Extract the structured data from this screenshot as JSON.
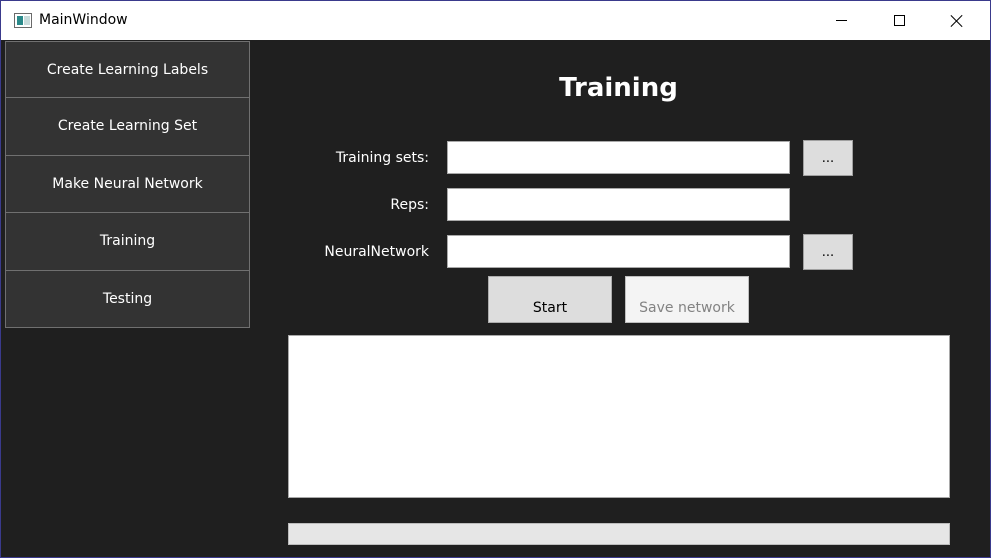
{
  "window": {
    "title": "MainWindow",
    "icons": {
      "app": "app-window-icon",
      "minimize": "minimize-icon",
      "maximize": "maximize-icon",
      "close": "close-icon"
    }
  },
  "sidebar": {
    "items": [
      {
        "label": "Create Learning Labels"
      },
      {
        "label": "Create Learning Set"
      },
      {
        "label": "Make Neural Network"
      },
      {
        "label": "Training"
      },
      {
        "label": "Testing"
      }
    ]
  },
  "main": {
    "title": "Training",
    "fields": {
      "training_sets": {
        "label": "Training sets:",
        "value": ""
      },
      "reps": {
        "label": "Reps:",
        "value": ""
      },
      "neural_network": {
        "label": "NeuralNetwork",
        "value": ""
      }
    },
    "browse_label": "...",
    "start_label": "Start",
    "save_label": "Save network",
    "log_text": "",
    "progress": 0
  },
  "colors": {
    "background": "#1f1f1f",
    "nav_button": "#333333",
    "button": "#dddddd",
    "disabled_text": "#838383"
  }
}
